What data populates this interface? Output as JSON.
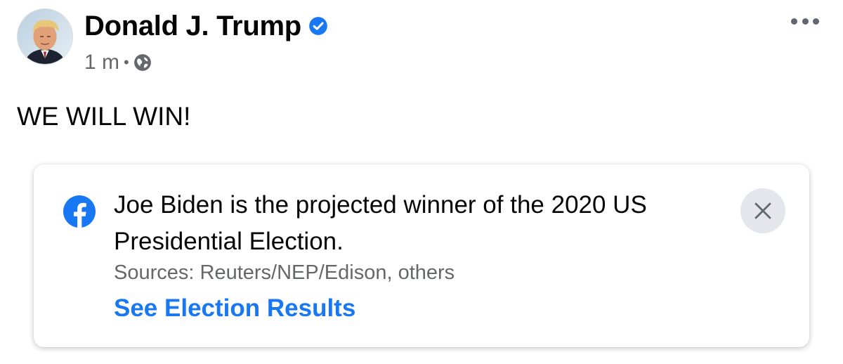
{
  "post": {
    "author": {
      "name": "Donald J. Trump",
      "verified": true,
      "avatar_icon": "profile-photo"
    },
    "meta": {
      "timestamp": "1 m",
      "separator": "•",
      "audience_icon": "globe-icon"
    },
    "more_icon": "more-horizontal-icon",
    "text": "WE WILL WIN!"
  },
  "info_label": {
    "icon": "facebook-logo-icon",
    "headline": "Joe Biden is the projected winner of the 2020 US Presidential Election.",
    "sources": "Sources: Reuters/NEP/Edison, others",
    "link_label": "See Election Results",
    "close_icon": "close-icon"
  },
  "colors": {
    "accent": "#1877f2",
    "text_primary": "#050505",
    "text_secondary": "#65676b",
    "close_bg": "#e4e6eb"
  }
}
